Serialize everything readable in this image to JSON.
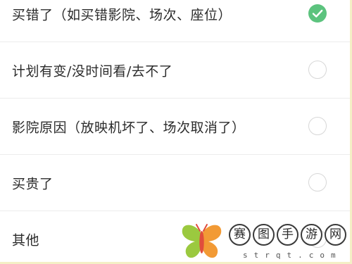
{
  "options": [
    {
      "label": "买错了（如买错影院、场次、座位）",
      "selected": true
    },
    {
      "label": "计划有变/没时间看/去不了",
      "selected": false
    },
    {
      "label": "影院原因（放映机坏了、场次取消了）",
      "selected": false
    },
    {
      "label": "买贵了",
      "selected": false
    },
    {
      "label": "其他",
      "selected": false
    }
  ],
  "watermark": {
    "chars": [
      "赛",
      "图",
      "手",
      "游",
      "网"
    ],
    "url": "strqt.com"
  },
  "colors": {
    "selected_radio": "#5cc37e",
    "unselected_radio_border": "#d7d7d7",
    "text": "#2b2b2b",
    "divider": "#ececec"
  }
}
